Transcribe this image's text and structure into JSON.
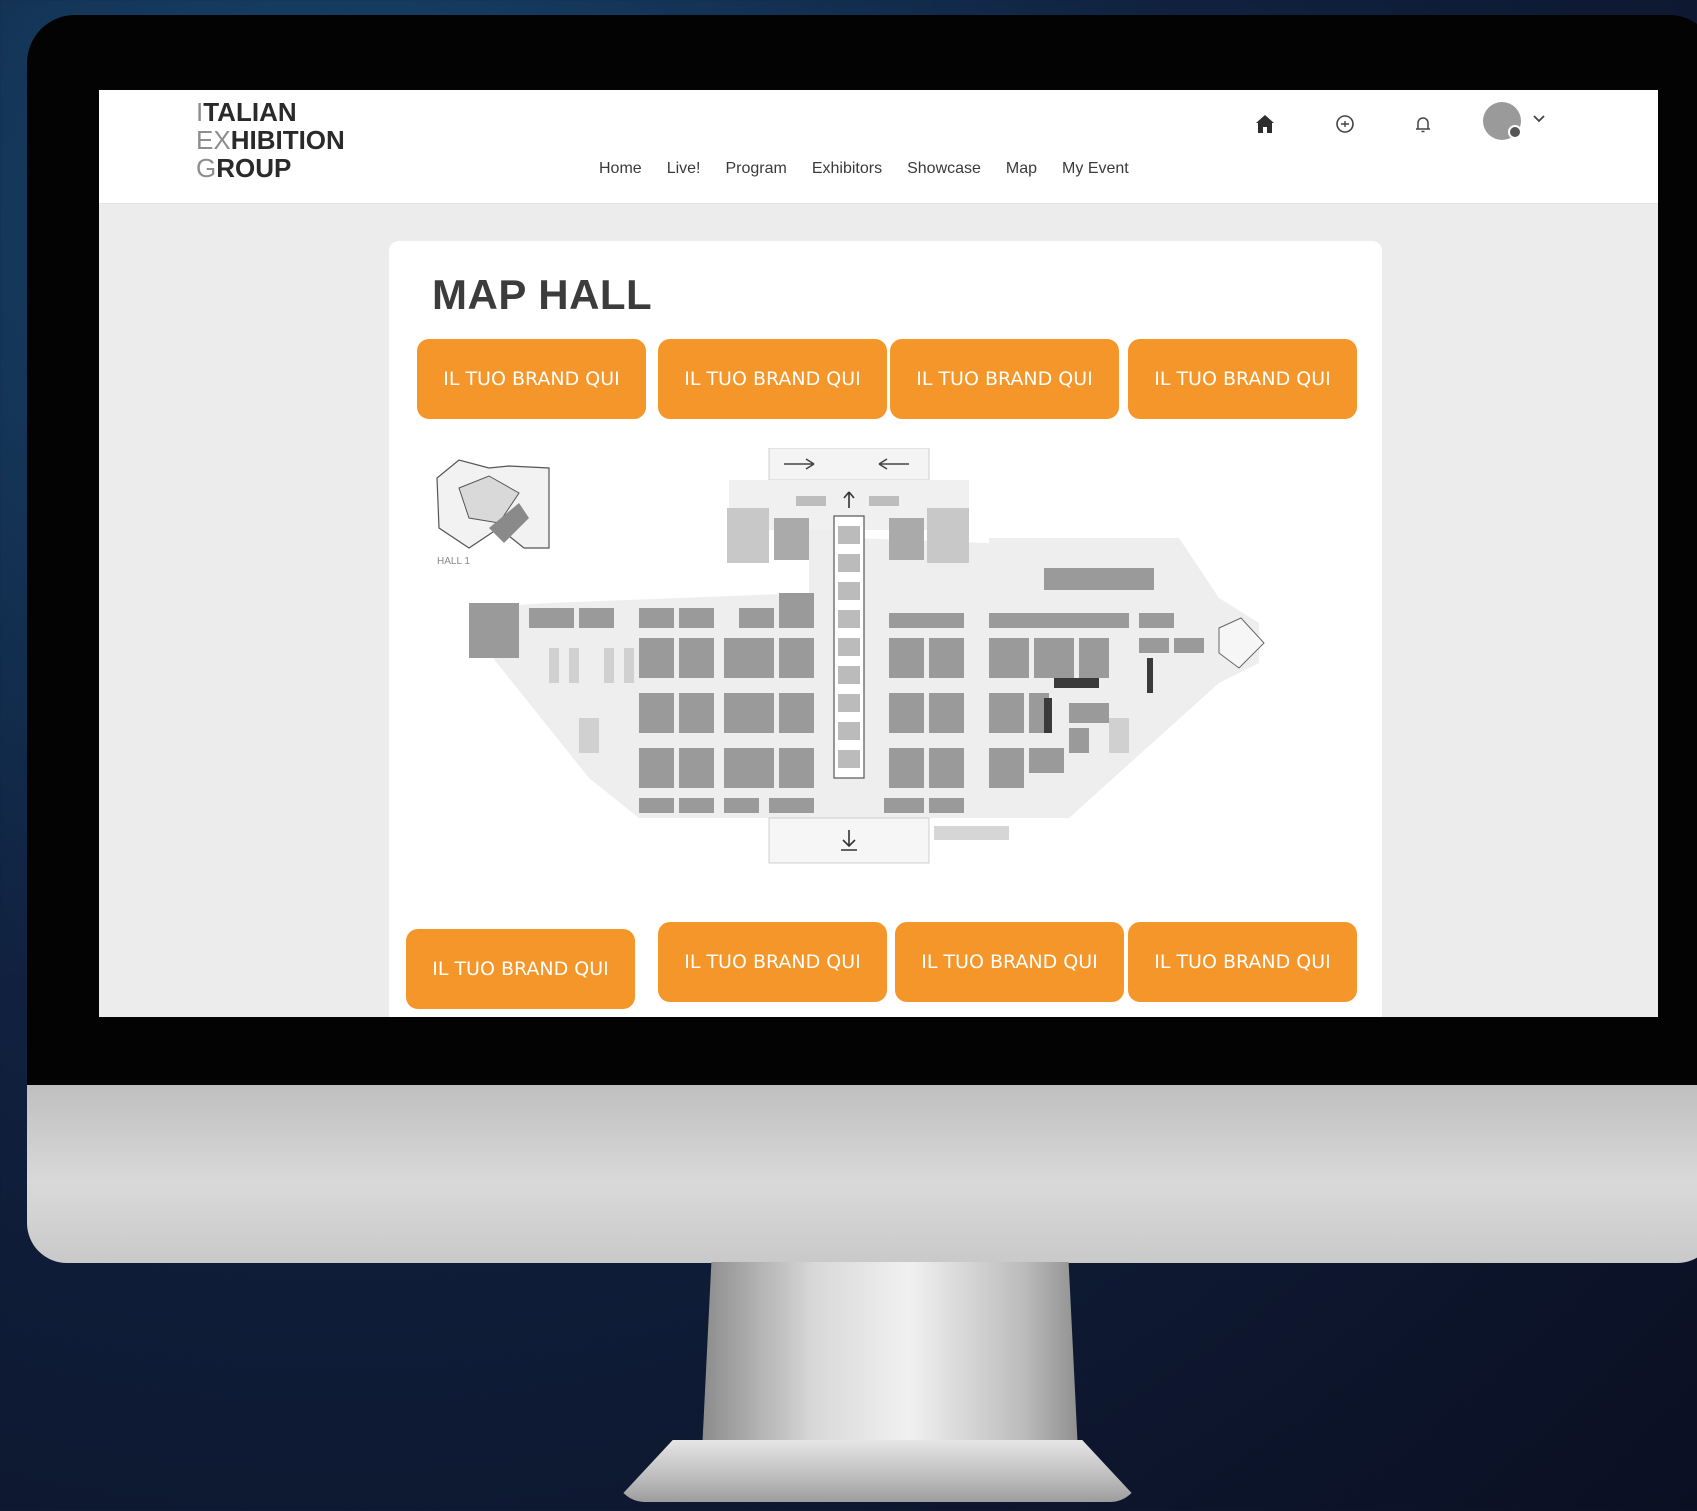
{
  "header": {
    "logo_lines": [
      {
        "accent": "I",
        "rest": "TALIAN"
      },
      {
        "accent": "EX",
        "rest": "HIBITION"
      },
      {
        "accent": "G",
        "rest": "ROUP"
      }
    ],
    "nav": [
      "Home",
      "Live!",
      "Program",
      "Exhibitors",
      "Showcase",
      "Map",
      "My Event"
    ]
  },
  "page": {
    "title": "MAP HALL",
    "banners_top": [
      "IL TUO BRAND QUI",
      "IL TUO BRAND QUI",
      "IL TUO BRAND QUI",
      "IL TUO BRAND QUI"
    ],
    "banners_bottom": [
      "IL TUO BRAND QUI",
      "IL TUO BRAND QUI",
      "IL TUO BRAND QUI",
      "IL TUO BRAND QUI"
    ],
    "map": {
      "hall_label": "HALL 1"
    }
  },
  "icons": {
    "home": "home-icon",
    "chat": "chat-icon",
    "notifications": "bell-icon",
    "profile": "avatar",
    "menu": "chevron-down-icon"
  },
  "colors": {
    "banner": "#f5962a",
    "banner_text": "#ffffff",
    "screen_background": "#ececec",
    "monitor_bezel": "#030303"
  }
}
